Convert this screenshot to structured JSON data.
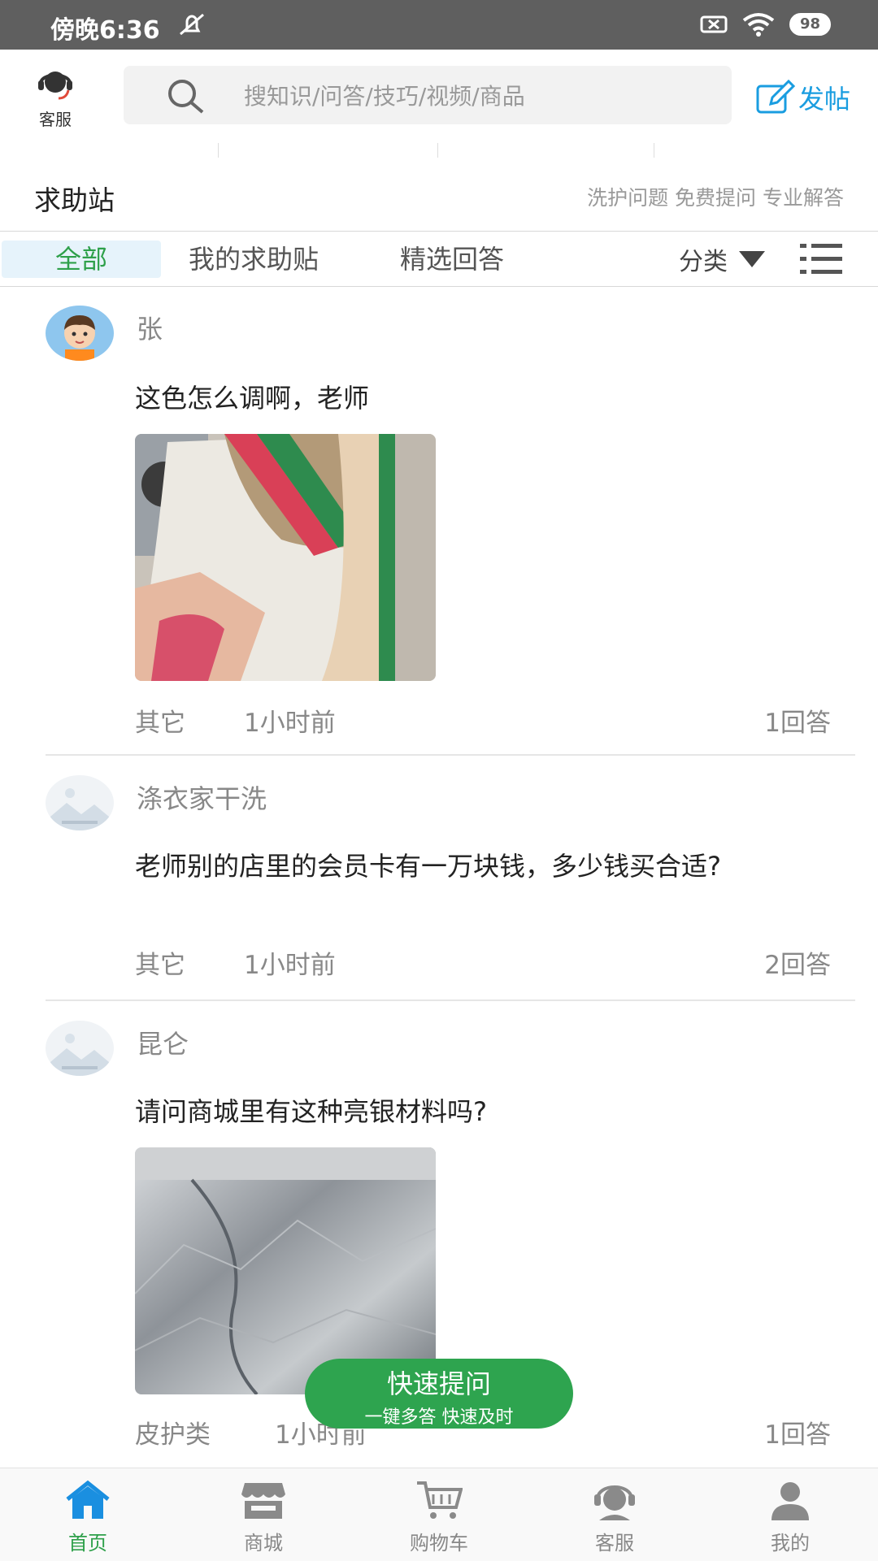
{
  "status_bar": {
    "time": "傍晚6:36",
    "battery": "98"
  },
  "header": {
    "customer_service_label": "客服",
    "search_placeholder": "搜知识/问答/技巧/视频/商品",
    "post_label": "发帖"
  },
  "section": {
    "title": "求助站",
    "subtitle": "洗护问题 免费提问 专业解答"
  },
  "tabs": [
    {
      "label": "全部",
      "active": true
    },
    {
      "label": "我的求助贴",
      "active": false
    },
    {
      "label": "精选回答",
      "active": false
    }
  ],
  "category_label": "分类",
  "posts": [
    {
      "user": "张",
      "text": "这色怎么调啊，老师",
      "category": "其它",
      "time": "1小时前",
      "answers": "1回答"
    },
    {
      "user": "涤衣家干洗",
      "text": "老师别的店里的会员卡有一万块钱，多少钱买合适?",
      "category": "其它",
      "time": "1小时前",
      "answers": "2回答"
    },
    {
      "user": "昆仑",
      "text": "请问商城里有这种亮银材料吗?",
      "category": "皮护类",
      "time": "1小时前",
      "answers": "1回答"
    }
  ],
  "quick_ask": {
    "title": "快速提问",
    "subtitle": "一键多答 快速及时"
  },
  "nav": [
    {
      "label": "首页",
      "icon": "home-icon",
      "active": true
    },
    {
      "label": "商城",
      "icon": "shop-icon",
      "active": false
    },
    {
      "label": "购物车",
      "icon": "cart-icon",
      "active": false
    },
    {
      "label": "客服",
      "icon": "headset-icon",
      "active": false
    },
    {
      "label": "我的",
      "icon": "user-icon",
      "active": false
    }
  ],
  "colors": {
    "accent_green": "#2ea04a",
    "post_blue": "#1a9de0",
    "status_bar": "#5f5f5f",
    "tab_active_bg": "#e6f3fb"
  }
}
